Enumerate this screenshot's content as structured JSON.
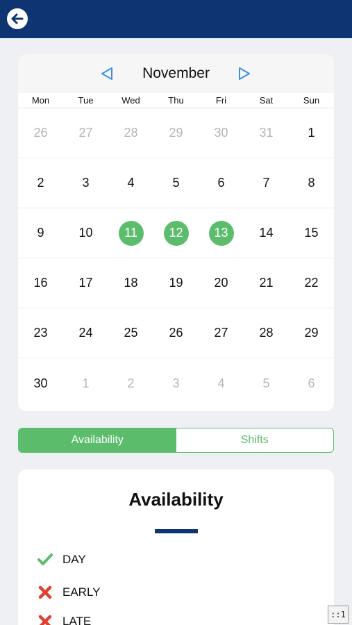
{
  "calendar": {
    "month": "November",
    "weekdays": [
      "Mon",
      "Tue",
      "Wed",
      "Thu",
      "Fri",
      "Sat",
      "Sun"
    ],
    "weeks": [
      [
        {
          "d": "26",
          "m": true
        },
        {
          "d": "27",
          "m": true
        },
        {
          "d": "28",
          "m": true
        },
        {
          "d": "29",
          "m": true
        },
        {
          "d": "30",
          "m": true
        },
        {
          "d": "31",
          "m": true
        },
        {
          "d": "1",
          "m": false
        }
      ],
      [
        {
          "d": "2"
        },
        {
          "d": "3"
        },
        {
          "d": "4"
        },
        {
          "d": "5"
        },
        {
          "d": "6"
        },
        {
          "d": "7"
        },
        {
          "d": "8"
        }
      ],
      [
        {
          "d": "9"
        },
        {
          "d": "10"
        },
        {
          "d": "11",
          "s": true
        },
        {
          "d": "12",
          "s": true
        },
        {
          "d": "13",
          "s": true
        },
        {
          "d": "14"
        },
        {
          "d": "15"
        }
      ],
      [
        {
          "d": "16"
        },
        {
          "d": "17"
        },
        {
          "d": "18"
        },
        {
          "d": "19"
        },
        {
          "d": "20"
        },
        {
          "d": "21"
        },
        {
          "d": "22"
        }
      ],
      [
        {
          "d": "23"
        },
        {
          "d": "24"
        },
        {
          "d": "25"
        },
        {
          "d": "26"
        },
        {
          "d": "27"
        },
        {
          "d": "28"
        },
        {
          "d": "29"
        }
      ],
      [
        {
          "d": "30"
        },
        {
          "d": "1",
          "m": true
        },
        {
          "d": "2",
          "m": true
        },
        {
          "d": "3",
          "m": true
        },
        {
          "d": "4",
          "m": true
        },
        {
          "d": "5",
          "m": true
        },
        {
          "d": "6",
          "m": true
        }
      ]
    ]
  },
  "tabs": {
    "availability": "Availability",
    "shifts": "Shifts"
  },
  "availability": {
    "title": "Availability",
    "items": [
      {
        "label": "DAY",
        "icon": "check-icon"
      },
      {
        "label": "EARLY",
        "icon": "cross-icon"
      },
      {
        "label": "LATE",
        "icon": "cross-icon"
      }
    ]
  },
  "badge": "::1",
  "colors": {
    "header": "#0e3472",
    "accent_green": "#5bbd6c",
    "cross_red": "#e0412f",
    "nav_blue": "#3d8ee0"
  }
}
